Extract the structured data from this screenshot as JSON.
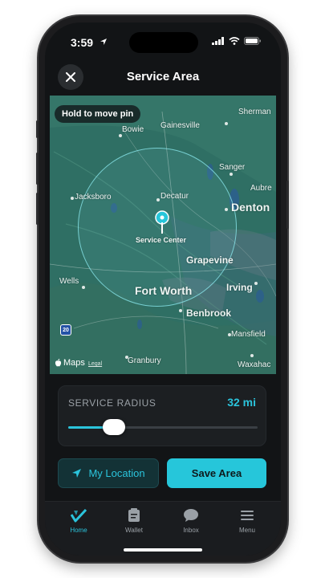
{
  "status_bar": {
    "time": "3:59"
  },
  "header": {
    "title": "Service Area"
  },
  "map": {
    "hint": "Hold to move pin",
    "pin_label": "Service Center",
    "places": [
      {
        "name": "Bowie",
        "size": "small"
      },
      {
        "name": "Gainesville",
        "size": "small"
      },
      {
        "name": "Sherman",
        "size": "small"
      },
      {
        "name": "Sanger",
        "size": "small"
      },
      {
        "name": "Aubre",
        "size": "small"
      },
      {
        "name": "Jacksboro",
        "size": "small"
      },
      {
        "name": "Decatur",
        "size": "small"
      },
      {
        "name": "Denton",
        "size": "big"
      },
      {
        "name": "Grapevine",
        "size": "mid"
      },
      {
        "name": "Wells",
        "size": "small"
      },
      {
        "name": "Fort Worth",
        "size": "big"
      },
      {
        "name": "Irving",
        "size": "mid"
      },
      {
        "name": "Benbrook",
        "size": "mid"
      },
      {
        "name": "Mansfield",
        "size": "small"
      },
      {
        "name": "Granbury",
        "size": "small"
      },
      {
        "name": "Waxahac",
        "size": "small"
      }
    ],
    "highway_shield": "20",
    "attribution": "Maps",
    "legal": "Legal"
  },
  "radius": {
    "label": "SERVICE RADIUS",
    "value": "32 mi",
    "fraction": 0.24
  },
  "actions": {
    "my_location": "My Location",
    "save": "Save Area"
  },
  "tabs": [
    {
      "label": "Home",
      "icon": "logo-check-icon",
      "active": true
    },
    {
      "label": "Wallet",
      "icon": "wallet-card-icon",
      "active": false
    },
    {
      "label": "Inbox",
      "icon": "chat-bubble-icon",
      "active": false
    },
    {
      "label": "Menu",
      "icon": "hamburger-menu-icon",
      "active": false
    }
  ],
  "colors": {
    "accent": "#26c6da",
    "background": "#121416",
    "map": "#2e6e63"
  }
}
